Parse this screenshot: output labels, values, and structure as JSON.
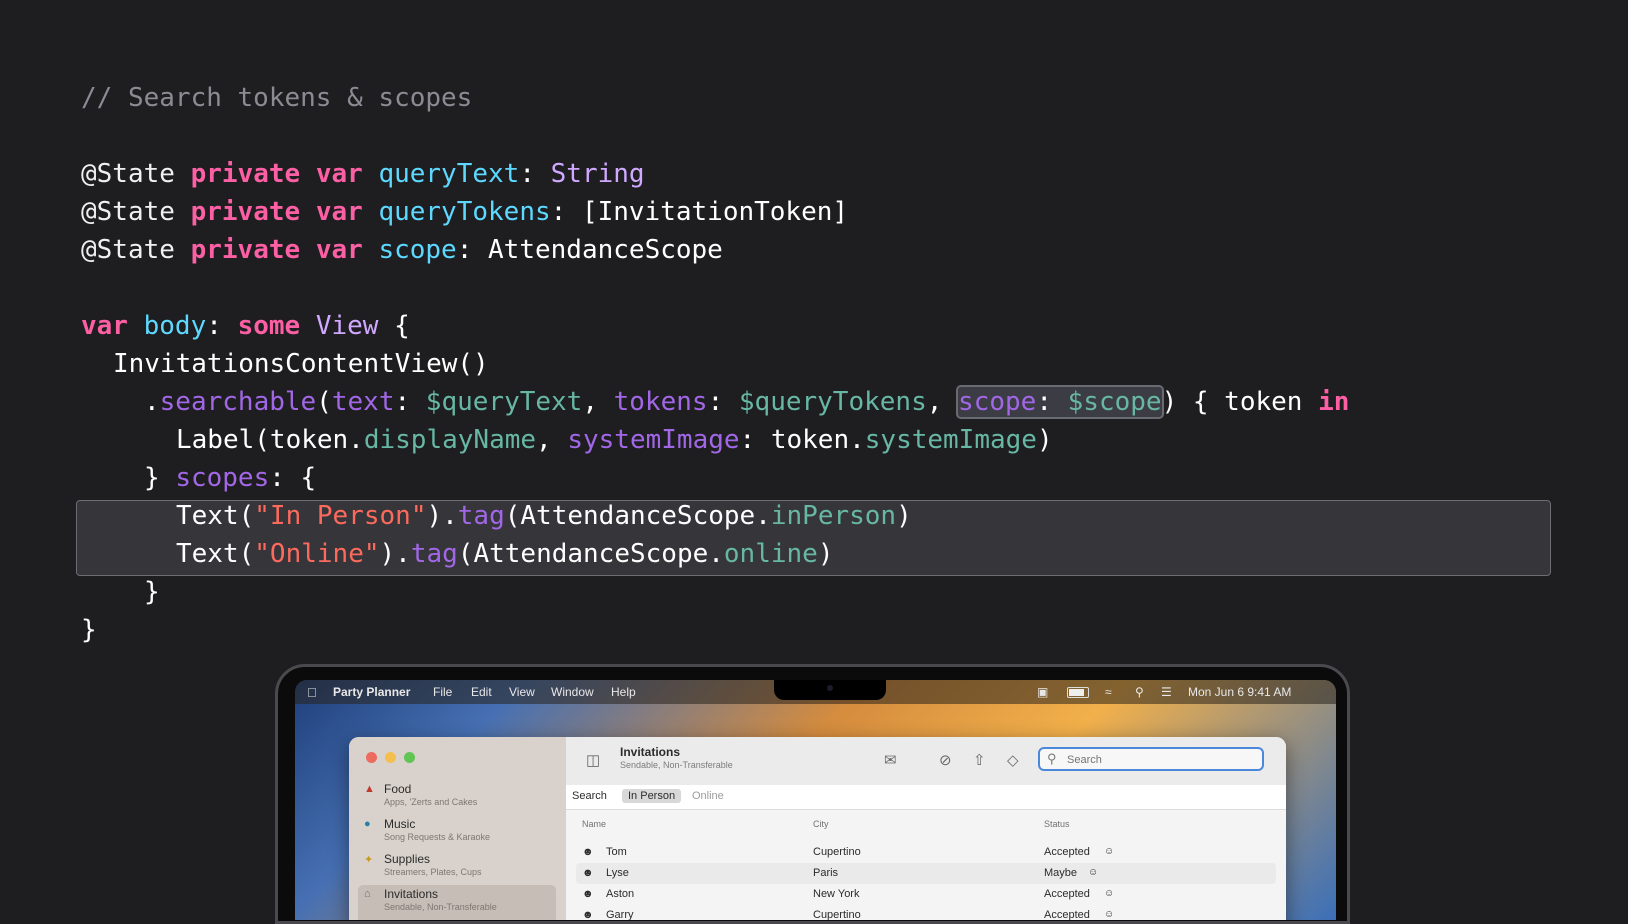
{
  "code": {
    "comment": "// Search tokens & scopes",
    "line1": {
      "attr": "@State",
      "kw1": "private",
      "kw2": "var",
      "name": "queryText",
      "colon": ": ",
      "type": "String"
    },
    "line2": {
      "attr": "@State",
      "kw1": "private",
      "kw2": "var",
      "name": "queryTokens",
      "colon": ": ",
      "type": "[InvitationToken]"
    },
    "line3": {
      "attr": "@State",
      "kw1": "private",
      "kw2": "var",
      "name": "scope",
      "colon": ": ",
      "type": "AttendanceScope"
    },
    "line4": {
      "kw": "var",
      "name": "body",
      "colon": ": ",
      "kw2": "some",
      "type": "View",
      "brace": " {"
    },
    "line5": {
      "text": "InvitationsContentView()"
    },
    "line6": {
      "dot": ".",
      "method": "searchable",
      "p1": "(",
      "a1": "text",
      "c1": ": ",
      "v1": "$queryText",
      "s1": ", ",
      "a2": "tokens",
      "c2": ": ",
      "v2": "$queryTokens",
      "s2": ", ",
      "a3": "scope",
      "c3": ": ",
      "v3": "$scope",
      "rest": ") { token ",
      "kw": "in"
    },
    "line7": {
      "label": "Label(token.",
      "p1": "displayName",
      "sep": ", ",
      "a": "systemImage",
      "c": ": token.",
      "p2": "systemImage",
      "end": ")"
    },
    "line8": {
      "brace": "} ",
      "arg": "scopes",
      "rest": ": {"
    },
    "line9": {
      "fn": "Text(",
      "str": "\"In Person\"",
      "mid": ").",
      "meth": "tag",
      "p": "(AttendanceScope.",
      "mem": "inPerson",
      "end": ")"
    },
    "line10": {
      "fn": "Text(",
      "str": "\"Online\"",
      "mid": ").",
      "meth": "tag",
      "p": "(AttendanceScope.",
      "mem": "online",
      "end": ")"
    },
    "line11": "}",
    "line12": "}"
  },
  "laptop": {
    "menubar": {
      "app": "Party Planner",
      "items": [
        "File",
        "Edit",
        "View",
        "Window",
        "Help"
      ],
      "clock": "Mon Jun 6  9:41 AM"
    },
    "sidebar": [
      {
        "title": "Food",
        "sub": "Apps, 'Zerts and Cakes",
        "icon": "food-icon"
      },
      {
        "title": "Music",
        "sub": "Song Requests & Karaoke",
        "icon": "music-icon"
      },
      {
        "title": "Supplies",
        "sub": "Streamers, Plates, Cups",
        "icon": "supplies-icon"
      },
      {
        "title": "Invitations",
        "sub": "Sendable, Non-Transferable",
        "icon": "invitations-icon"
      }
    ],
    "toolbar": {
      "title": "Invitations",
      "subtitle": "Sendable, Non-Transferable"
    },
    "search": {
      "placeholder": "Search"
    },
    "scopes": {
      "label": "Search",
      "selected": "In Person",
      "other": "Online"
    },
    "table": {
      "columns": [
        "Name",
        "City",
        "Status"
      ],
      "rows": [
        {
          "name": "Tom",
          "city": "Cupertino",
          "status": "Accepted"
        },
        {
          "name": "Lyse",
          "city": "Paris",
          "status": "Maybe"
        },
        {
          "name": "Aston",
          "city": "New York",
          "status": "Accepted"
        },
        {
          "name": "Garry",
          "city": "Cupertino",
          "status": "Accepted"
        }
      ]
    }
  }
}
